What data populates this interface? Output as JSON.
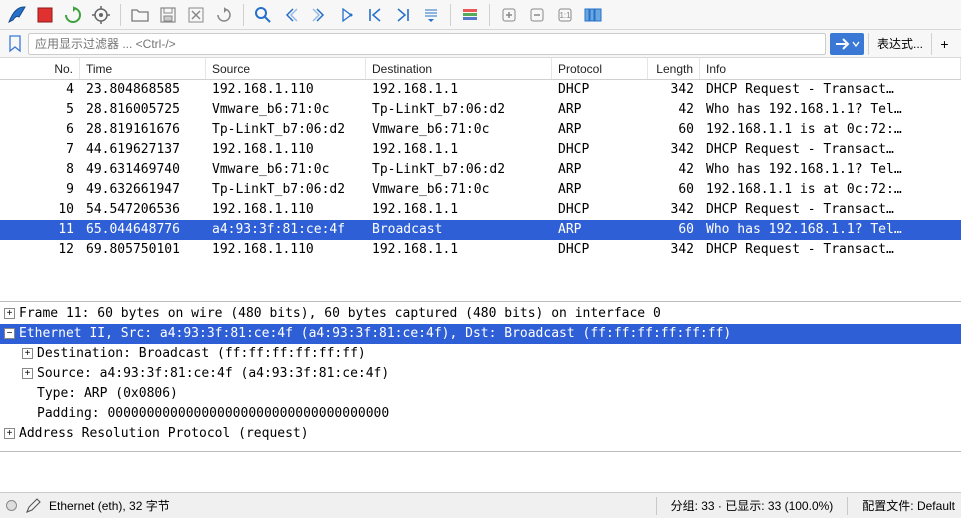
{
  "filter": {
    "placeholder": "应用显示过滤器 ... <Ctrl-/>",
    "expression_label": "表达式..."
  },
  "columns": {
    "no": "No.",
    "time": "Time",
    "source": "Source",
    "destination": "Destination",
    "protocol": "Protocol",
    "length": "Length",
    "info": "Info"
  },
  "packets": [
    {
      "no": "4",
      "time": "23.804868585",
      "source": "192.168.1.110",
      "destination": "192.168.1.1",
      "protocol": "DHCP",
      "length": "342",
      "info": "DHCP Request  - Transact…",
      "selected": false
    },
    {
      "no": "5",
      "time": "28.816005725",
      "source": "Vmware_b6:71:0c",
      "destination": "Tp-LinkT_b7:06:d2",
      "protocol": "ARP",
      "length": "42",
      "info": "Who has 192.168.1.1? Tel…",
      "selected": false
    },
    {
      "no": "6",
      "time": "28.819161676",
      "source": "Tp-LinkT_b7:06:d2",
      "destination": "Vmware_b6:71:0c",
      "protocol": "ARP",
      "length": "60",
      "info": "192.168.1.1 is at 0c:72:…",
      "selected": false
    },
    {
      "no": "7",
      "time": "44.619627137",
      "source": "192.168.1.110",
      "destination": "192.168.1.1",
      "protocol": "DHCP",
      "length": "342",
      "info": "DHCP Request  - Transact…",
      "selected": false
    },
    {
      "no": "8",
      "time": "49.631469740",
      "source": "Vmware_b6:71:0c",
      "destination": "Tp-LinkT_b7:06:d2",
      "protocol": "ARP",
      "length": "42",
      "info": "Who has 192.168.1.1? Tel…",
      "selected": false
    },
    {
      "no": "9",
      "time": "49.632661947",
      "source": "Tp-LinkT_b7:06:d2",
      "destination": "Vmware_b6:71:0c",
      "protocol": "ARP",
      "length": "60",
      "info": "192.168.1.1 is at 0c:72:…",
      "selected": false
    },
    {
      "no": "10",
      "time": "54.547206536",
      "source": "192.168.1.110",
      "destination": "192.168.1.1",
      "protocol": "DHCP",
      "length": "342",
      "info": "DHCP Request  - Transact…",
      "selected": false
    },
    {
      "no": "11",
      "time": "65.044648776",
      "source": "a4:93:3f:81:ce:4f",
      "destination": "Broadcast",
      "protocol": "ARP",
      "length": "60",
      "info": "Who has 192.168.1.1? Tel…",
      "selected": true
    },
    {
      "no": "12",
      "time": "69.805750101",
      "source": "192.168.1.110",
      "destination": "192.168.1.1",
      "protocol": "DHCP",
      "length": "342",
      "info": "DHCP Request  - Transact…",
      "selected": false
    }
  ],
  "details": [
    {
      "level": 0,
      "expander": "plus",
      "text": "Frame 11: 60 bytes on wire (480 bits), 60 bytes captured (480 bits) on interface 0",
      "selected": false
    },
    {
      "level": 0,
      "expander": "minus",
      "text": "Ethernet II, Src: a4:93:3f:81:ce:4f (a4:93:3f:81:ce:4f), Dst: Broadcast (ff:ff:ff:ff:ff:ff)",
      "selected": true
    },
    {
      "level": 1,
      "expander": "plus",
      "text": "Destination: Broadcast (ff:ff:ff:ff:ff:ff)",
      "selected": false
    },
    {
      "level": 1,
      "expander": "plus",
      "text": "Source: a4:93:3f:81:ce:4f (a4:93:3f:81:ce:4f)",
      "selected": false
    },
    {
      "level": 1,
      "expander": "none",
      "text": "Type: ARP (0x0806)",
      "selected": false
    },
    {
      "level": 1,
      "expander": "none",
      "text": "Padding: 000000000000000000000000000000000000",
      "selected": false
    },
    {
      "level": 0,
      "expander": "plus",
      "text": "Address Resolution Protocol (request)",
      "selected": false
    }
  ],
  "status": {
    "left": "Ethernet (eth), 32 字节",
    "packets": "分组: 33 · 已显示: 33 (100.0%)",
    "profile": "配置文件: Default"
  }
}
